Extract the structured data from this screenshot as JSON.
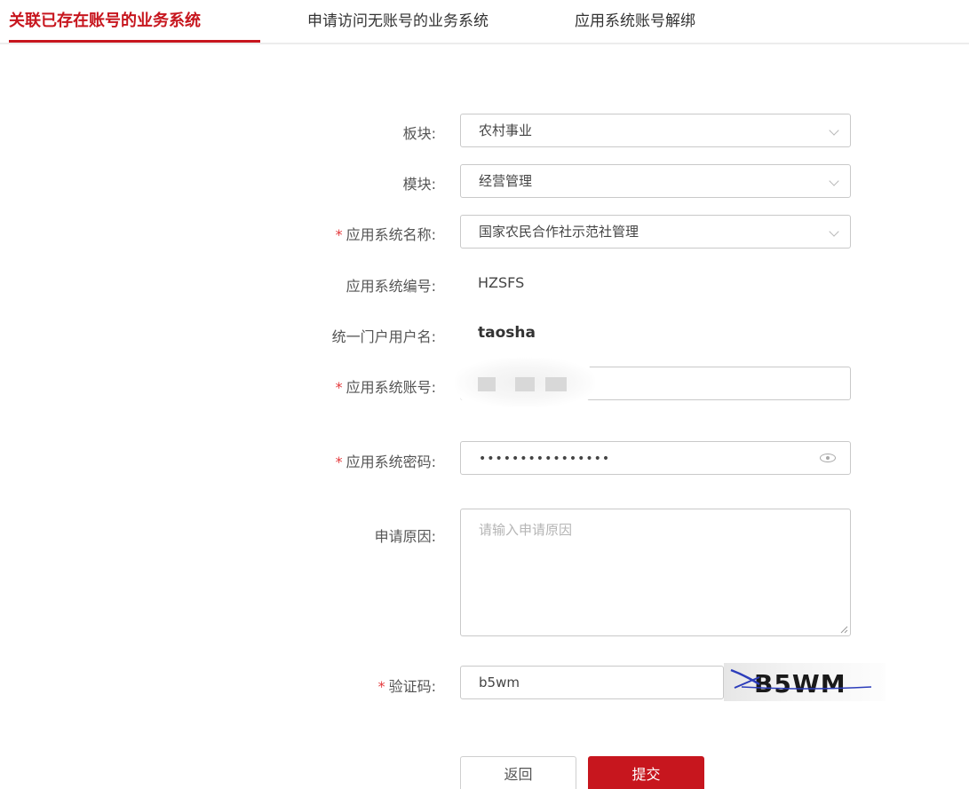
{
  "tabs": [
    {
      "label": "关联已存在账号的业务系统",
      "active": true
    },
    {
      "label": "申请访问无账号的业务系统",
      "active": false
    },
    {
      "label": "应用系统账号解绑",
      "active": false
    }
  ],
  "form": {
    "sector": {
      "label": "板块:",
      "value": "农村事业"
    },
    "module": {
      "label": "模块:",
      "value": "经营管理"
    },
    "app_name": {
      "required": "*",
      "label": "应用系统名称:",
      "value": "国家农民合作社示范社管理"
    },
    "app_code": {
      "label": "应用系统编号:",
      "value": "HZSFS"
    },
    "portal_user": {
      "label": "统一门户用户名:",
      "value": "taosha"
    },
    "app_account": {
      "required": "*",
      "label": "应用系统账号:"
    },
    "app_password": {
      "required": "*",
      "label": "应用系统密码:",
      "value": "••••••••••••••••"
    },
    "reason": {
      "label": "申请原因:",
      "placeholder": "请输入申请原因"
    },
    "captcha": {
      "required": "*",
      "label": "验证码:",
      "value": "b5wm",
      "image_text": "B5WM"
    }
  },
  "buttons": {
    "back": "返回",
    "submit": "提交"
  },
  "colors": {
    "accent": "#c7161e",
    "required": "#e4393c"
  }
}
